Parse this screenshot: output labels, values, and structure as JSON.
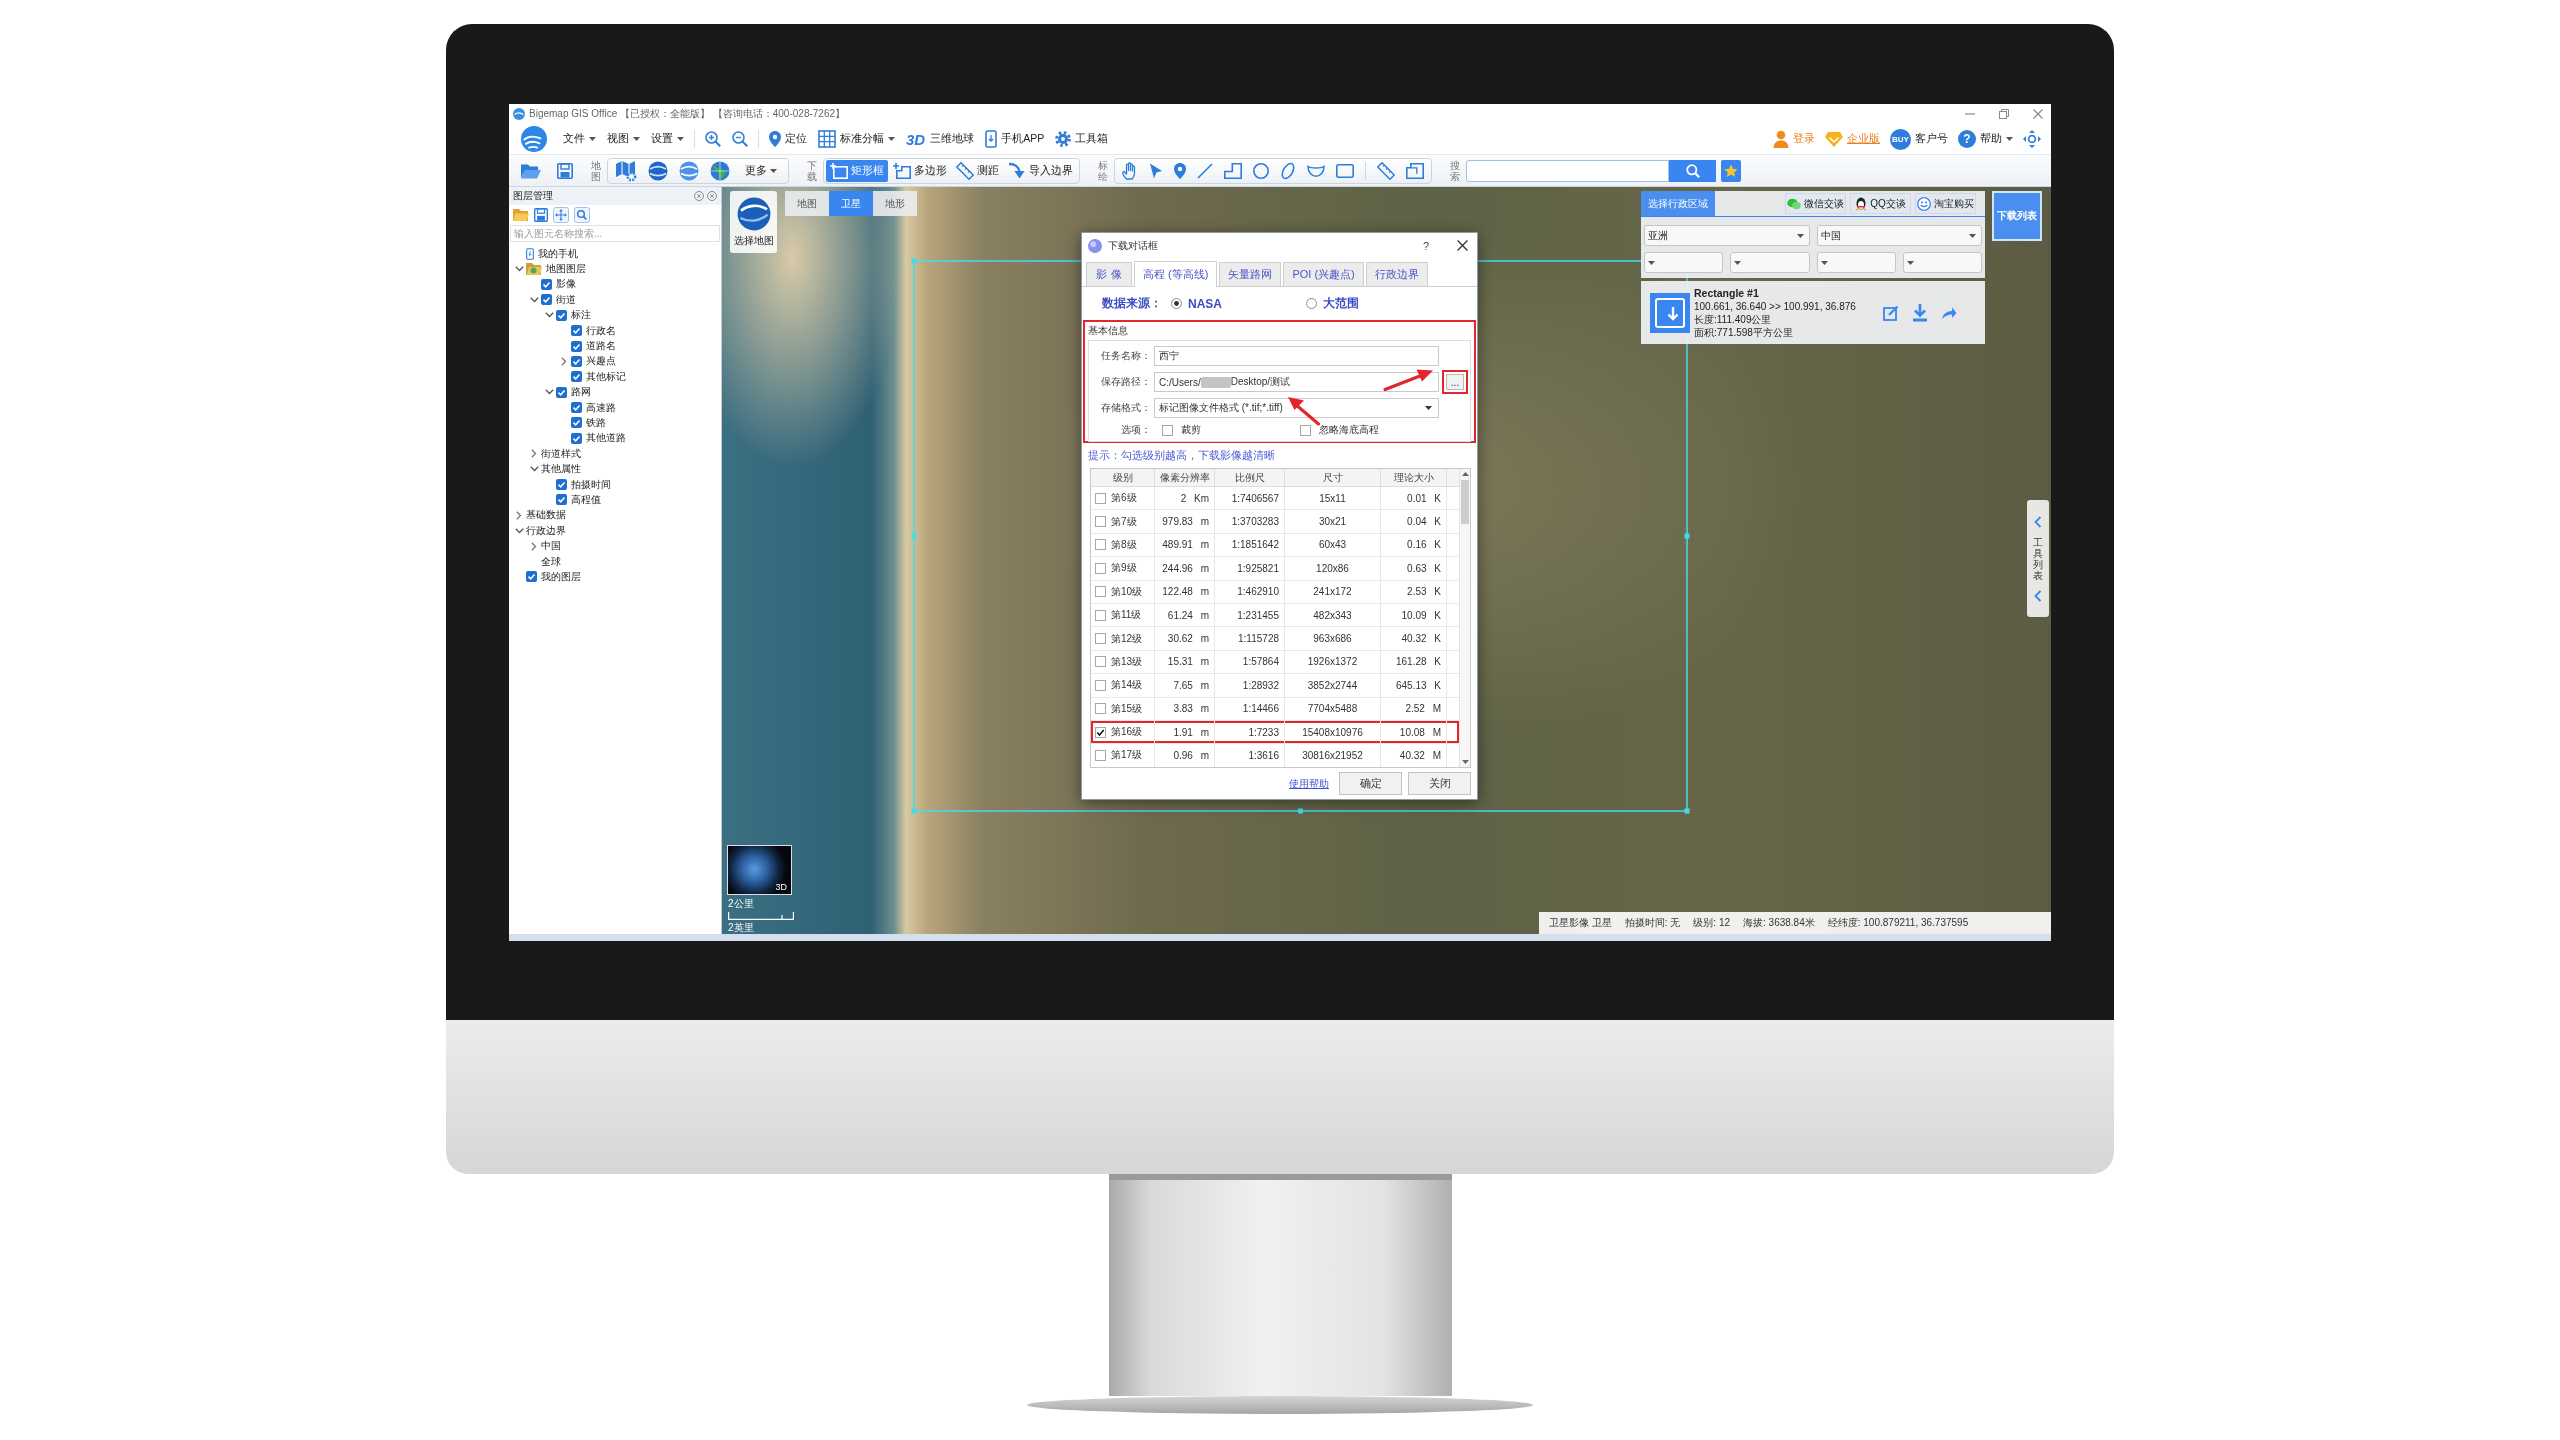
{
  "window": {
    "title": "Bigemap GIS Office 【已授权：全能版】 【咨询电话：400-028-7262】"
  },
  "menu_bar": {
    "groups": [
      [
        {
          "kind": "menu",
          "label": "文件",
          "caret": true
        },
        {
          "kind": "menu",
          "label": "视图",
          "caret": true
        },
        {
          "kind": "menu",
          "label": "设置",
          "caret": true
        }
      ],
      [
        {
          "kind": "zoom_in"
        },
        {
          "kind": "zoom_out"
        }
      ],
      [
        {
          "kind": "locate",
          "label": "定位",
          "caret": false
        },
        {
          "kind": "grid",
          "label": "标准分幅",
          "caret": true
        },
        {
          "kind": "globe3d",
          "badge": "3D",
          "label": "三维地球",
          "caret": false
        },
        {
          "kind": "phone",
          "label": "手机APP",
          "caret": false
        },
        {
          "kind": "toolbox",
          "label": "工具箱",
          "caret": false
        }
      ]
    ],
    "account": [
      {
        "kind": "user",
        "label": "登录",
        "caret": false
      },
      {
        "kind": "vip",
        "label": "企业版",
        "caret": false
      },
      {
        "kind": "buy",
        "badge": "BUY",
        "label": "客户号",
        "caret": false
      },
      {
        "kind": "help",
        "badge": "?",
        "label": "帮助",
        "caret": true
      },
      {
        "kind": "navigate"
      }
    ]
  },
  "toolbar": {
    "file_buttons": [
      {
        "kind": "open"
      },
      {
        "kind": "save"
      }
    ],
    "groups": [
      {
        "title": "地图",
        "items": [
          {
            "kind": "map_layers"
          },
          {
            "kind": "globe_blue"
          },
          {
            "kind": "globe_light"
          },
          {
            "kind": "globe_green"
          },
          {
            "kind": "more",
            "label": "更多",
            "caret": true
          }
        ]
      },
      {
        "title": "下载",
        "items": [
          {
            "kind": "rectangle_select",
            "label": "矩形框",
            "selected": true
          },
          {
            "kind": "polygon_select",
            "label": "多边形",
            "selected": false
          },
          {
            "kind": "measure",
            "label": "测距",
            "selected": false
          },
          {
            "kind": "import_boundary",
            "label": "导入边界",
            "selected": false
          }
        ]
      },
      {
        "title": "标绘",
        "items": [
          {
            "kind": "hand"
          },
          {
            "kind": "pointer"
          },
          {
            "kind": "pin"
          },
          {
            "kind": "line"
          },
          {
            "kind": "step_line"
          },
          {
            "kind": "circle"
          },
          {
            "kind": "ellipse"
          },
          {
            "kind": "arc"
          },
          {
            "kind": "rectangle"
          },
          {
            "kind": "separator"
          },
          {
            "kind": "tag"
          },
          {
            "kind": "shape_edit"
          }
        ]
      }
    ],
    "search": {
      "title": "搜索"
    }
  },
  "layer_panel": {
    "title": "图层管理",
    "search": {
      "placeholder": "输入图元名称搜索..."
    },
    "tree": [
      {
        "kind": "phone",
        "label": "我的手机"
      },
      {
        "kind": "folder",
        "label": "地图图层",
        "expanded": true,
        "children": [
          {
            "kind": "check",
            "label": "影像",
            "checked": true
          },
          {
            "kind": "check",
            "label": "街道",
            "checked": true,
            "expanded": true,
            "children": [
              {
                "kind": "check",
                "label": "标注",
                "checked": true,
                "expanded": true,
                "children": [
                  {
                    "kind": "check",
                    "label": "行政名",
                    "checked": true
                  },
                  {
                    "kind": "check",
                    "label": "道路名",
                    "checked": true
                  },
                  {
                    "kind": "check",
                    "label": "兴趣点",
                    "checked": true,
                    "expanded": false
                  },
                  {
                    "kind": "check",
                    "label": "其他标记",
                    "checked": true
                  }
                ]
              },
              {
                "kind": "check",
                "label": "路网",
                "checked": true,
                "expanded": true,
                "children": [
                  {
                    "kind": "check",
                    "label": "高速路",
                    "checked": true
                  },
                  {
                    "kind": "check",
                    "label": "铁路",
                    "checked": true
                  },
                  {
                    "kind": "check",
                    "label": "其他道路",
                    "checked": true
                  }
                ]
              }
            ]
          },
          {
            "kind": "plain",
            "label": "街道样式",
            "expanded": false
          },
          {
            "kind": "plain",
            "label": "其他属性",
            "expanded": true,
            "children": [
              {
                "kind": "check",
                "label": "拍摄时间",
                "checked": true
              },
              {
                "kind": "check",
                "label": "高程值",
                "checked": true
              }
            ]
          }
        ]
      },
      {
        "kind": "plain",
        "label": "基础数据",
        "expanded": false
      },
      {
        "kind": "plain",
        "label": "行政边界",
        "expanded": true,
        "children": [
          {
            "kind": "plain",
            "label": "中国",
            "expanded": false
          },
          {
            "kind": "plain",
            "label": "全球"
          }
        ]
      },
      {
        "kind": "check",
        "label": "我的图层",
        "checked": true
      }
    ]
  },
  "map": {
    "switch_label": "选择地图",
    "tabs": [
      {
        "label": "地图",
        "selected": false
      },
      {
        "label": "卫星",
        "selected": true
      },
      {
        "label": "地形",
        "selected": false
      }
    ],
    "globe_label": "3D",
    "scale_labels": [
      "2公里",
      "2英里"
    ],
    "download_list": "下载列表",
    "tool_list": "工具列表",
    "status": [
      "卫星影像 卫星",
      "拍摄时间: 无",
      "级别: 12",
      "海拔: 3638.84米",
      "经纬度: 100.879211, 36.737595"
    ]
  },
  "region_panel": {
    "tabs": [
      {
        "label": "选择行政区域",
        "selected": true
      }
    ],
    "contacts": [
      {
        "kind": "wechat",
        "label": "微信交谈"
      },
      {
        "kind": "qq",
        "label": "QQ交谈"
      },
      {
        "kind": "taobao",
        "label": "淘宝购买"
      }
    ],
    "selects": [
      {
        "kind": "wide",
        "value": "亚洲"
      },
      {
        "kind": "wide",
        "value": "中国"
      },
      {
        "kind": "narrow"
      },
      {
        "kind": "narrow"
      },
      {
        "kind": "narrow"
      },
      {
        "kind": "narrow"
      }
    ],
    "record": {
      "title": "Rectangle #1",
      "coordinates": "100.661, 36.640 >> 100.991, 36.876",
      "length": "长度:111.409公里",
      "area": "面积:771.598平方公里"
    }
  },
  "dialog": {
    "title": "下载对话框",
    "help": "?",
    "tabs": [
      {
        "label": "影 像",
        "selected": false
      },
      {
        "label": "高程 (等高线)",
        "selected": true
      },
      {
        "label": "矢量路网",
        "selected": false
      },
      {
        "label": "POI (兴趣点)",
        "selected": false
      },
      {
        "label": "行政边界",
        "selected": false
      }
    ],
    "source": {
      "label": "数据来源：",
      "options": [
        {
          "label": "NASA",
          "selected": true
        },
        {
          "label": "大范围",
          "selected": false
        }
      ]
    },
    "basic_info": {
      "title": "基本信息",
      "highlighted": true,
      "fields": [
        {
          "kind": "text",
          "label": "任务名称：",
          "value": "西宁",
          "annotated": false
        },
        {
          "kind": "path",
          "label": "保存路径：",
          "value_start": "C:/Users/",
          "value_end": "Desktop/测试",
          "browse": "...",
          "browse_highlighted": true,
          "annotated": true
        },
        {
          "kind": "select",
          "label": "存储格式：",
          "value": "标记图像文件格式 (*.tif;*.tiff)",
          "annotated": true
        },
        {
          "kind": "options",
          "label": "选项：",
          "annotated": false,
          "checkboxes": [
            {
              "label": "裁剪",
              "checked": false
            },
            {
              "label": "忽略海底高程",
              "checked": false
            }
          ]
        }
      ]
    },
    "hint": "提示：勾选级别越高，下载影像越清晰",
    "table": {
      "columns": [
        "级别",
        "像素分辨率",
        "比例尺",
        "尺寸",
        "理论大小"
      ],
      "rows": [
        {
          "checked": false,
          "highlighted": false,
          "name": "第6级",
          "resolution": "2 Km",
          "scale": "1:7406567",
          "dimensions": "15x11",
          "size": "0.01 K"
        },
        {
          "checked": false,
          "highlighted": false,
          "name": "第7级",
          "resolution": "979.83 m",
          "scale": "1:3703283",
          "dimensions": "30x21",
          "size": "0.04 K"
        },
        {
          "checked": false,
          "highlighted": false,
          "name": "第8级",
          "resolution": "489.91 m",
          "scale": "1:1851642",
          "dimensions": "60x43",
          "size": "0.16 K"
        },
        {
          "checked": false,
          "highlighted": false,
          "name": "第9级",
          "resolution": "244.96 m",
          "scale": "1:925821",
          "dimensions": "120x86",
          "size": "0.63 K"
        },
        {
          "checked": false,
          "highlighted": false,
          "name": "第10级",
          "resolution": "122.48 m",
          "scale": "1:462910",
          "dimensions": "241x172",
          "size": "2.53 K"
        },
        {
          "checked": false,
          "highlighted": false,
          "name": "第11级",
          "resolution": "61.24 m",
          "scale": "1:231455",
          "dimensions": "482x343",
          "size": "10.09 K"
        },
        {
          "checked": false,
          "highlighted": false,
          "name": "第12级",
          "resolution": "30.62 m",
          "scale": "1:115728",
          "dimensions": "963x686",
          "size": "40.32 K"
        },
        {
          "checked": false,
          "highlighted": false,
          "name": "第13级",
          "resolution": "15.31 m",
          "scale": "1:57864",
          "dimensions": "1926x1372",
          "size": "161.28 K"
        },
        {
          "checked": false,
          "highlighted": false,
          "name": "第14级",
          "resolution": "7.65 m",
          "scale": "1:28932",
          "dimensions": "3852x2744",
          "size": "645.13 K"
        },
        {
          "checked": false,
          "highlighted": false,
          "name": "第15级",
          "resolution": "3.83 m",
          "scale": "1:14466",
          "dimensions": "7704x5488",
          "size": "2.52 M"
        },
        {
          "checked": true,
          "highlighted": true,
          "name": "第16级",
          "resolution": "1.91 m",
          "scale": "1:7233",
          "dimensions": "15408x10976",
          "size": "10.08 M"
        },
        {
          "checked": false,
          "highlighted": false,
          "name": "第17级",
          "resolution": "0.96 m",
          "scale": "1:3616",
          "dimensions": "30816x21952",
          "size": "40.32 M"
        }
      ]
    },
    "help_link": "使用帮助",
    "buttons": [
      "确定",
      "关闭"
    ]
  }
}
